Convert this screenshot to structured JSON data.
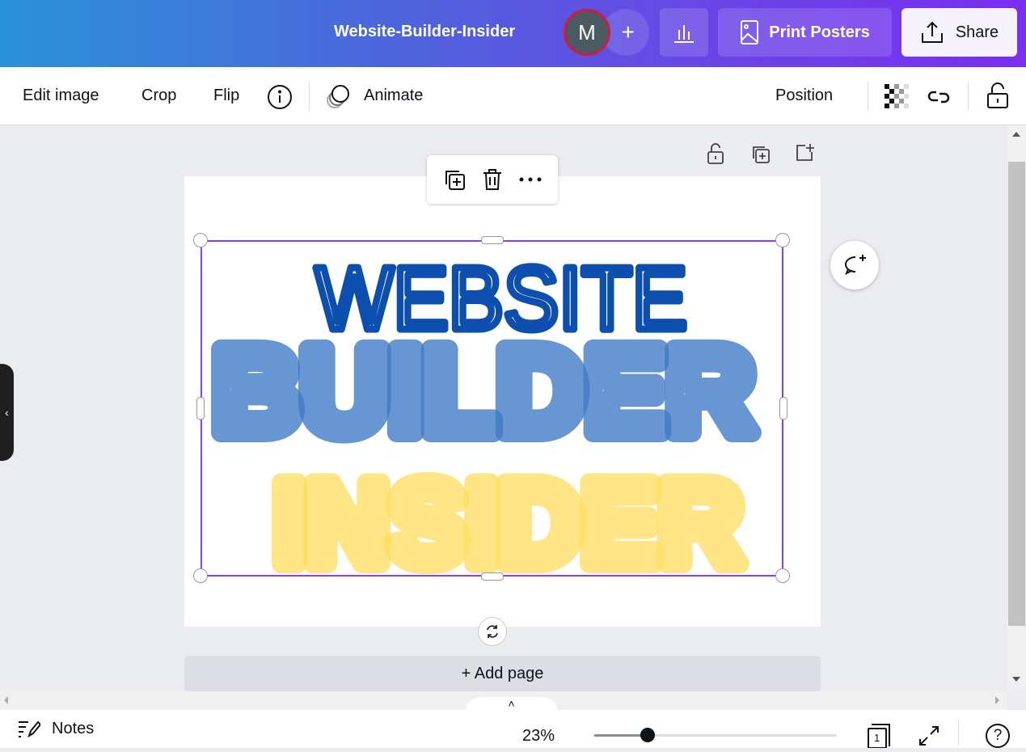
{
  "header": {
    "title": "Website-Builder-Insider",
    "avatar_initial": "M",
    "add_collaborator": "+",
    "print_label": "Print Posters",
    "share_label": "Share"
  },
  "toolbar": {
    "edit_image": "Edit image",
    "crop": "Crop",
    "flip": "Flip",
    "animate": "Animate",
    "position": "Position"
  },
  "artwork": {
    "line1": "WEBSITE",
    "line2": "BUILDER",
    "line3": "INSIDER",
    "colors": {
      "line1": "#0d4fae",
      "line2": "#3d78c6",
      "line3": "#ffdc5c"
    }
  },
  "canvas": {
    "add_page": "+ Add page"
  },
  "footer": {
    "notes": "Notes",
    "zoom_label": "23%",
    "zoom_percent": 23,
    "page_count": "1"
  },
  "colors": {
    "accent": "#8b3dff",
    "avatar_ring": "#d01c3c"
  }
}
